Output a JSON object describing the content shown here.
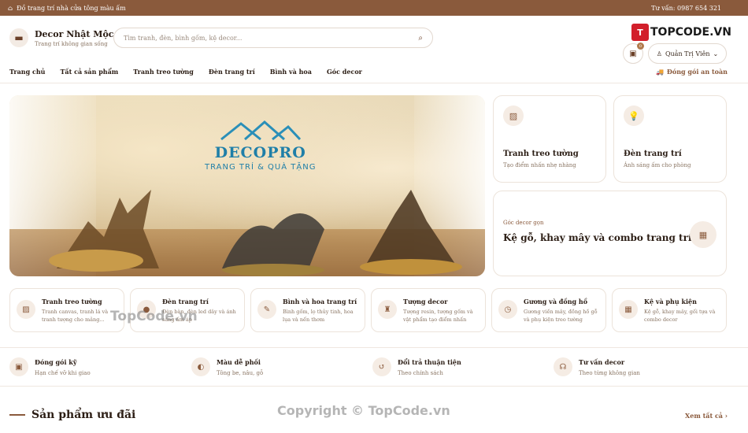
{
  "topbar": {
    "promo": "Đồ trang trí nhà cửa tông màu ấm",
    "hotline": "Tư vấn: 0987 654 321"
  },
  "header": {
    "brand_name": "Decor Nhật Mộc",
    "brand_tagline": "Trang trí không gian sống",
    "search_placeholder": "Tìm tranh, đèn, bình gốm, kệ decor...",
    "cart_count": "0",
    "user_label": "Quản Trị Viên"
  },
  "nav": {
    "items": [
      "Trang chủ",
      "Tất cả sản phẩm",
      "Tranh treo tường",
      "Đèn trang trí",
      "Bình và hoa",
      "Góc decor"
    ],
    "shipping": "Đóng gói an toàn"
  },
  "hero": {
    "logo_text": "DECOPRO",
    "logo_sub": "TRANG TRÍ & QUÀ TẶNG"
  },
  "side_cards": [
    {
      "title": "Tranh treo tường",
      "desc": "Tạo điểm nhấn nhẹ nhàng",
      "icon": "image-icon"
    },
    {
      "title": "Đèn trang trí",
      "desc": "Ánh sáng ấm cho phòng",
      "icon": "lamp-icon"
    }
  ],
  "corner_card": {
    "eyebrow": "Góc decor gọn",
    "title": "Kệ gỗ, khay mây và combo trang trí",
    "icon": "boxes-icon"
  },
  "categories": [
    {
      "title": "Tranh treo tường",
      "desc": "Tranh canvas, tranh lá và tranh tượng cho mảng...",
      "icon": "image-icon"
    },
    {
      "title": "Đèn trang trí",
      "desc": "Đèn bàn, đèn led dây và ánh sáng ấm áp",
      "icon": "bulb-icon"
    },
    {
      "title": "Bình và hoa trang trí",
      "desc": "Bình gốm, lọ thủy tinh, hoa lụa và nến thơm",
      "icon": "brush-icon"
    },
    {
      "title": "Tượng decor",
      "desc": "Tượng resin, tượng gốm và vật phẩm tạo điểm nhấn",
      "icon": "statue-icon"
    },
    {
      "title": "Gương và đồng hồ",
      "desc": "Gương viền mây, đồng hồ gỗ và phụ kiện treo tường",
      "icon": "clock-icon"
    },
    {
      "title": "Kệ và phụ kiện",
      "desc": "Kệ gỗ, khay mây, gối tựa và combo decor",
      "icon": "boxes-icon"
    }
  ],
  "features": [
    {
      "title": "Đóng gói kỹ",
      "desc": "Hạn chế vỡ khi giao",
      "icon": "box-icon"
    },
    {
      "title": "Màu dễ phối",
      "desc": "Tông be, nâu, gỗ",
      "icon": "palette-icon"
    },
    {
      "title": "Đổi trả thuận tiện",
      "desc": "Theo chính sách",
      "icon": "refresh-icon"
    },
    {
      "title": "Tư vấn decor",
      "desc": "Theo từng không gian",
      "icon": "headset-icon"
    }
  ],
  "section": {
    "title": "Sản phẩm ưu đãi",
    "see_all": "Xem tất cả"
  },
  "watermarks": {
    "top": "TOPCODE.VN",
    "top_logo": "T",
    "mid": "TopCode.vn",
    "bottom": "Copyright © TopCode.vn"
  }
}
